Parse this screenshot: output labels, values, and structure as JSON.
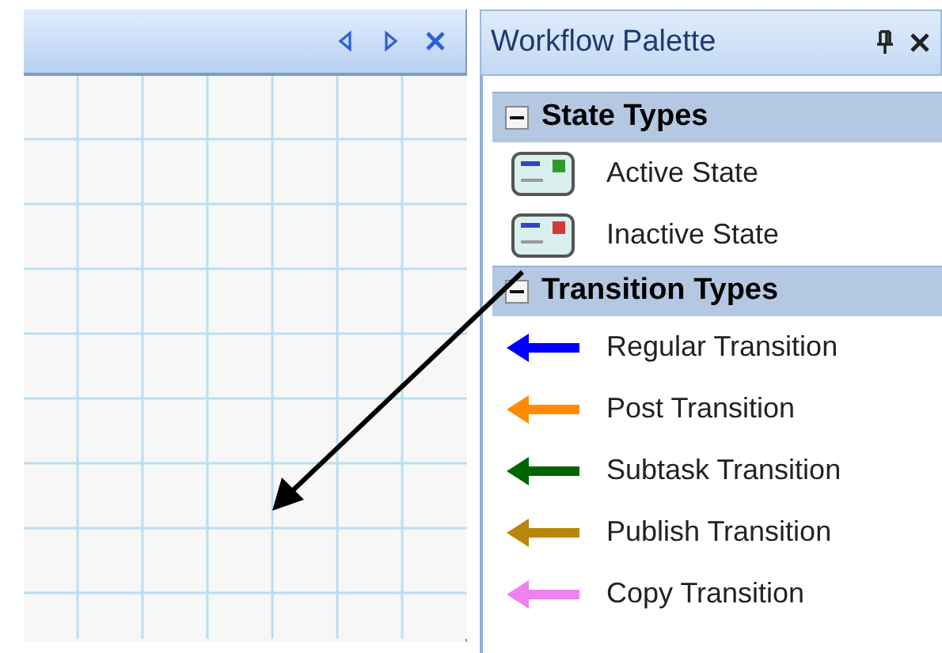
{
  "document_tab": {
    "buttons": [
      {
        "kind": "prev"
      },
      {
        "kind": "next"
      },
      {
        "kind": "close"
      }
    ]
  },
  "palette": {
    "title": "Workflow Palette",
    "sections": [
      {
        "title": "State Types",
        "expanded": true,
        "items": [
          {
            "label": "Active State",
            "kind": "state",
            "color": "#2e9a2e"
          },
          {
            "label": "Inactive State",
            "kind": "state",
            "color": "#d23a3a"
          }
        ]
      },
      {
        "title": "Transition Types",
        "expanded": true,
        "items": [
          {
            "label": "Regular Transition",
            "kind": "transition",
            "color": "#0000ff"
          },
          {
            "label": "Post Transition",
            "kind": "transition",
            "color": "#ff8c00"
          },
          {
            "label": "Subtask Transition",
            "kind": "transition",
            "color": "#006400"
          },
          {
            "label": "Publish Transition",
            "kind": "transition",
            "color": "#b8860b"
          },
          {
            "label": "Copy Transition",
            "kind": "transition",
            "color": "#ee82ee"
          }
        ]
      }
    ]
  }
}
